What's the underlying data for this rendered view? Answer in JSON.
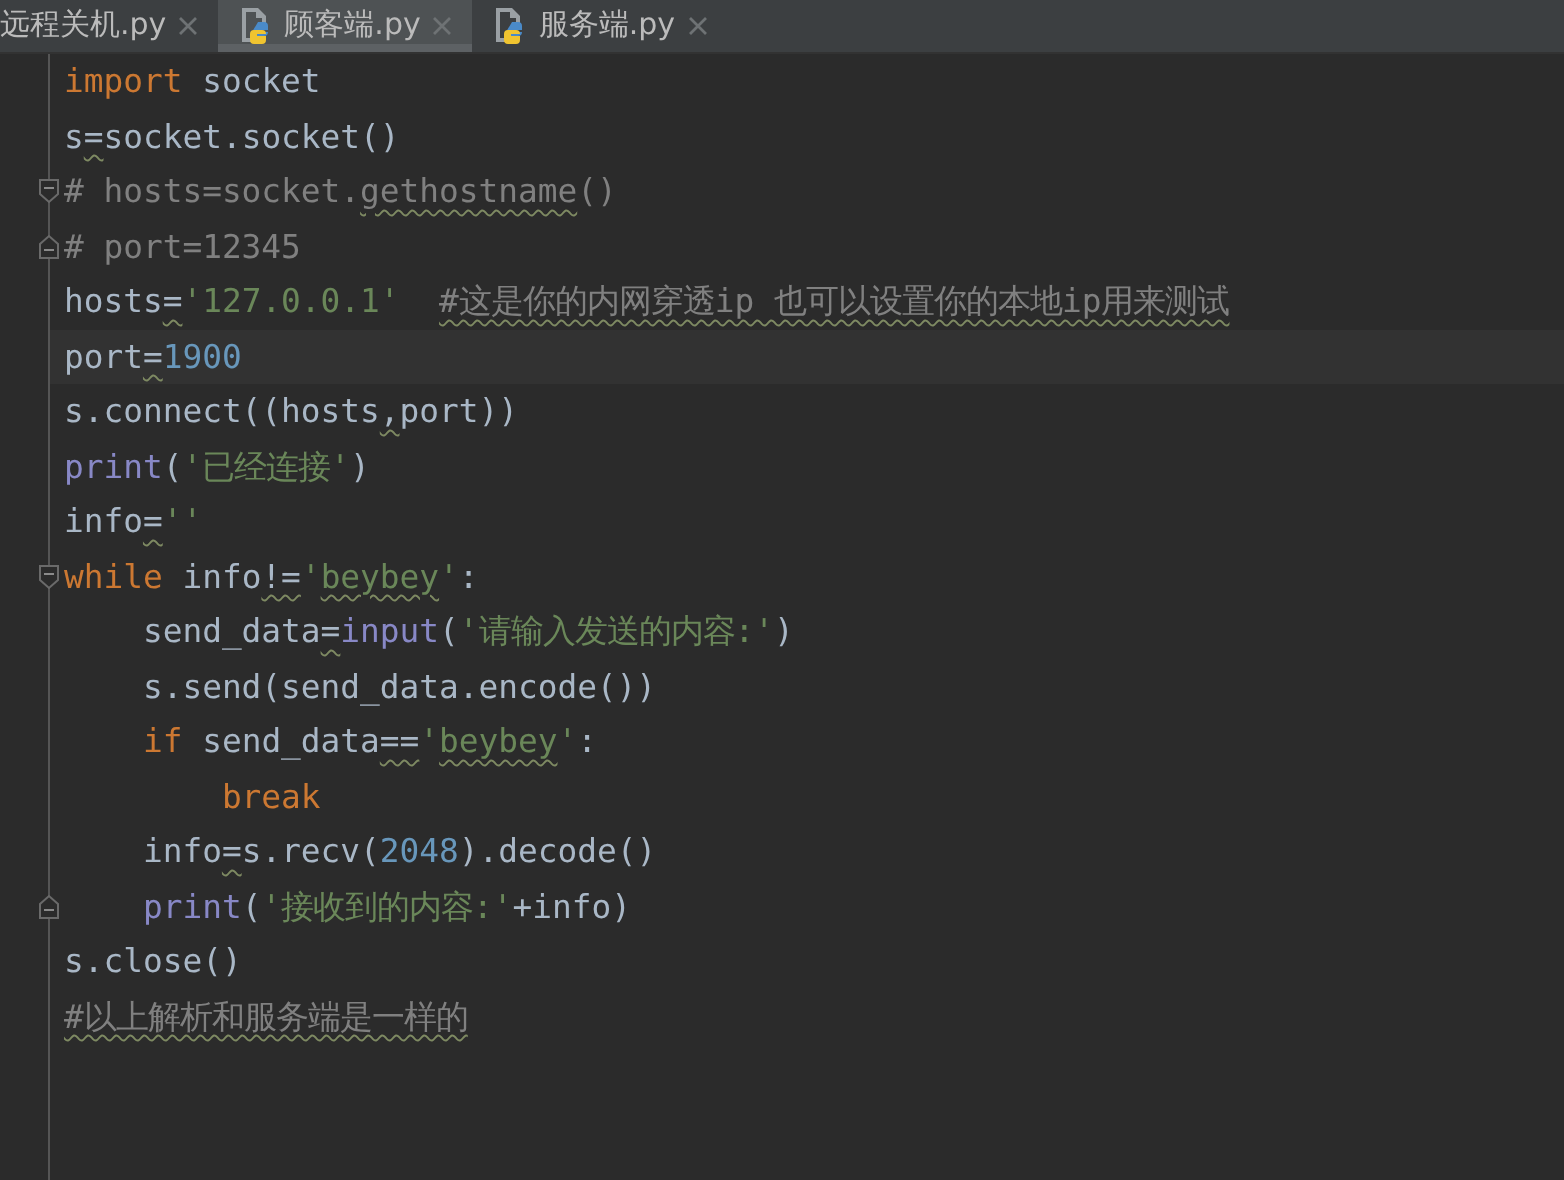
{
  "tabs": [
    {
      "label": "远程关机.py",
      "selected": false,
      "icon": false
    },
    {
      "label": "顾客端.py",
      "selected": true,
      "icon": true
    },
    {
      "label": "服务端.py",
      "selected": false,
      "icon": true
    }
  ],
  "editor": {
    "lines": [
      {
        "current": false,
        "fold_start": false,
        "fold_end": false,
        "tokens": [
          {
            "kind": "keyword",
            "text": "import"
          },
          {
            "kind": "plain",
            "text": " socket"
          }
        ]
      },
      {
        "current": false,
        "fold_start": false,
        "fold_end": false,
        "tokens": [
          {
            "kind": "plain",
            "text": "s"
          },
          {
            "kind": "plain",
            "text": "=",
            "squiggle": true
          },
          {
            "kind": "plain",
            "text": "socket.socket()"
          }
        ]
      },
      {
        "current": false,
        "fold_start": true,
        "fold_end": false,
        "tokens": [
          {
            "kind": "comment",
            "text": "# hosts=socket."
          },
          {
            "kind": "comment",
            "text": "gethostname",
            "squiggle": true
          },
          {
            "kind": "comment",
            "text": "()"
          }
        ]
      },
      {
        "current": false,
        "fold_start": false,
        "fold_end": true,
        "tokens": [
          {
            "kind": "comment",
            "text": "# port=12345"
          }
        ]
      },
      {
        "current": false,
        "fold_start": false,
        "fold_end": false,
        "tokens": [
          {
            "kind": "plain",
            "text": "hosts"
          },
          {
            "kind": "plain",
            "text": "=",
            "squiggle": true
          },
          {
            "kind": "string",
            "text": "'127.0.0.1'  "
          },
          {
            "kind": "comment",
            "text": "#这是你的内网穿透ip 也可以设置你的本地ip用来测试",
            "squiggle": true
          }
        ]
      },
      {
        "current": true,
        "fold_start": false,
        "fold_end": false,
        "tokens": [
          {
            "kind": "plain",
            "text": "port"
          },
          {
            "kind": "plain",
            "text": "=",
            "squiggle": true
          },
          {
            "kind": "number",
            "text": "1900"
          }
        ]
      },
      {
        "current": false,
        "fold_start": false,
        "fold_end": false,
        "tokens": [
          {
            "kind": "plain",
            "text": "s.connect((hosts"
          },
          {
            "kind": "plain",
            "text": ",",
            "squiggle": true
          },
          {
            "kind": "plain",
            "text": "port))"
          }
        ]
      },
      {
        "current": false,
        "fold_start": false,
        "fold_end": false,
        "tokens": [
          {
            "kind": "builtin",
            "text": "print"
          },
          {
            "kind": "plain",
            "text": "("
          },
          {
            "kind": "string",
            "text": "'已经连接'"
          },
          {
            "kind": "plain",
            "text": ")"
          }
        ]
      },
      {
        "current": false,
        "fold_start": false,
        "fold_end": false,
        "tokens": [
          {
            "kind": "plain",
            "text": "info"
          },
          {
            "kind": "plain",
            "text": "=",
            "squiggle": true
          },
          {
            "kind": "string",
            "text": "''"
          }
        ]
      },
      {
        "current": false,
        "fold_start": true,
        "fold_end": false,
        "tokens": [
          {
            "kind": "keyword",
            "text": "while"
          },
          {
            "kind": "plain",
            "text": " info"
          },
          {
            "kind": "plain",
            "text": "!=",
            "squiggle": true
          },
          {
            "kind": "string",
            "text": "'"
          },
          {
            "kind": "string",
            "text": "beybey",
            "squiggle": true
          },
          {
            "kind": "string",
            "text": "'"
          },
          {
            "kind": "plain",
            "text": ":"
          }
        ]
      },
      {
        "current": false,
        "fold_start": false,
        "fold_end": false,
        "tokens": [
          {
            "kind": "plain",
            "text": "    send_data"
          },
          {
            "kind": "plain",
            "text": "=",
            "squiggle": true
          },
          {
            "kind": "builtin",
            "text": "input"
          },
          {
            "kind": "plain",
            "text": "("
          },
          {
            "kind": "string",
            "text": "'请输入发送的内容:'"
          },
          {
            "kind": "plain",
            "text": ")"
          }
        ]
      },
      {
        "current": false,
        "fold_start": false,
        "fold_end": false,
        "tokens": [
          {
            "kind": "plain",
            "text": "    s.send(send_data.encode())"
          }
        ]
      },
      {
        "current": false,
        "fold_start": false,
        "fold_end": false,
        "tokens": [
          {
            "kind": "keyword",
            "text": "    if"
          },
          {
            "kind": "plain",
            "text": " send_data"
          },
          {
            "kind": "plain",
            "text": "==",
            "squiggle": true
          },
          {
            "kind": "string",
            "text": "'"
          },
          {
            "kind": "string",
            "text": "beybey",
            "squiggle": true
          },
          {
            "kind": "string",
            "text": "'"
          },
          {
            "kind": "plain",
            "text": ":"
          }
        ]
      },
      {
        "current": false,
        "fold_start": false,
        "fold_end": false,
        "tokens": [
          {
            "kind": "keyword",
            "text": "        break"
          }
        ]
      },
      {
        "current": false,
        "fold_start": false,
        "fold_end": false,
        "tokens": [
          {
            "kind": "plain",
            "text": "    info"
          },
          {
            "kind": "plain",
            "text": "=",
            "squiggle": true
          },
          {
            "kind": "plain",
            "text": "s.recv("
          },
          {
            "kind": "number",
            "text": "2048"
          },
          {
            "kind": "plain",
            "text": ").decode()"
          }
        ]
      },
      {
        "current": false,
        "fold_start": false,
        "fold_end": true,
        "tokens": [
          {
            "kind": "builtin",
            "text": "    print"
          },
          {
            "kind": "plain",
            "text": "("
          },
          {
            "kind": "string",
            "text": "'接收到的内容:'"
          },
          {
            "kind": "plain",
            "text": "+info)"
          }
        ]
      },
      {
        "current": false,
        "fold_start": false,
        "fold_end": false,
        "tokens": [
          {
            "kind": "plain",
            "text": "s.close()"
          }
        ]
      },
      {
        "current": false,
        "fold_start": false,
        "fold_end": false,
        "tokens": [
          {
            "kind": "comment",
            "text": "#以上解析和服务端是一样的",
            "squiggle": true
          }
        ]
      }
    ]
  }
}
